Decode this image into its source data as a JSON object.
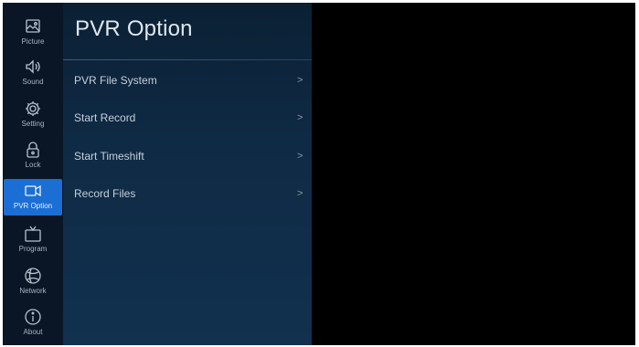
{
  "sidebar": {
    "items": [
      {
        "label": "Picture",
        "icon": "picture-icon"
      },
      {
        "label": "Sound",
        "icon": "speaker-icon"
      },
      {
        "label": "Setting",
        "icon": "gear-icon"
      },
      {
        "label": "Lock",
        "icon": "lock-icon"
      },
      {
        "label": "PVR Option",
        "icon": "video-camera-icon",
        "active": true
      },
      {
        "label": "Program",
        "icon": "tv-icon"
      },
      {
        "label": "Network",
        "icon": "globe-icon"
      },
      {
        "label": "About",
        "icon": "info-icon"
      }
    ]
  },
  "panel": {
    "title": "PVR Option",
    "menu": [
      {
        "label": "PVR File System",
        "chevron": ">"
      },
      {
        "label": "Start Record",
        "chevron": ">"
      },
      {
        "label": "Start Timeshift",
        "chevron": ">"
      },
      {
        "label": "Record Files",
        "chevron": ">"
      }
    ]
  },
  "colors": {
    "active_item": "#1b6fd4",
    "sidebar_bg": "#0a1626",
    "panel_bg": "#0f2a44",
    "screen_bg": "#000000"
  }
}
